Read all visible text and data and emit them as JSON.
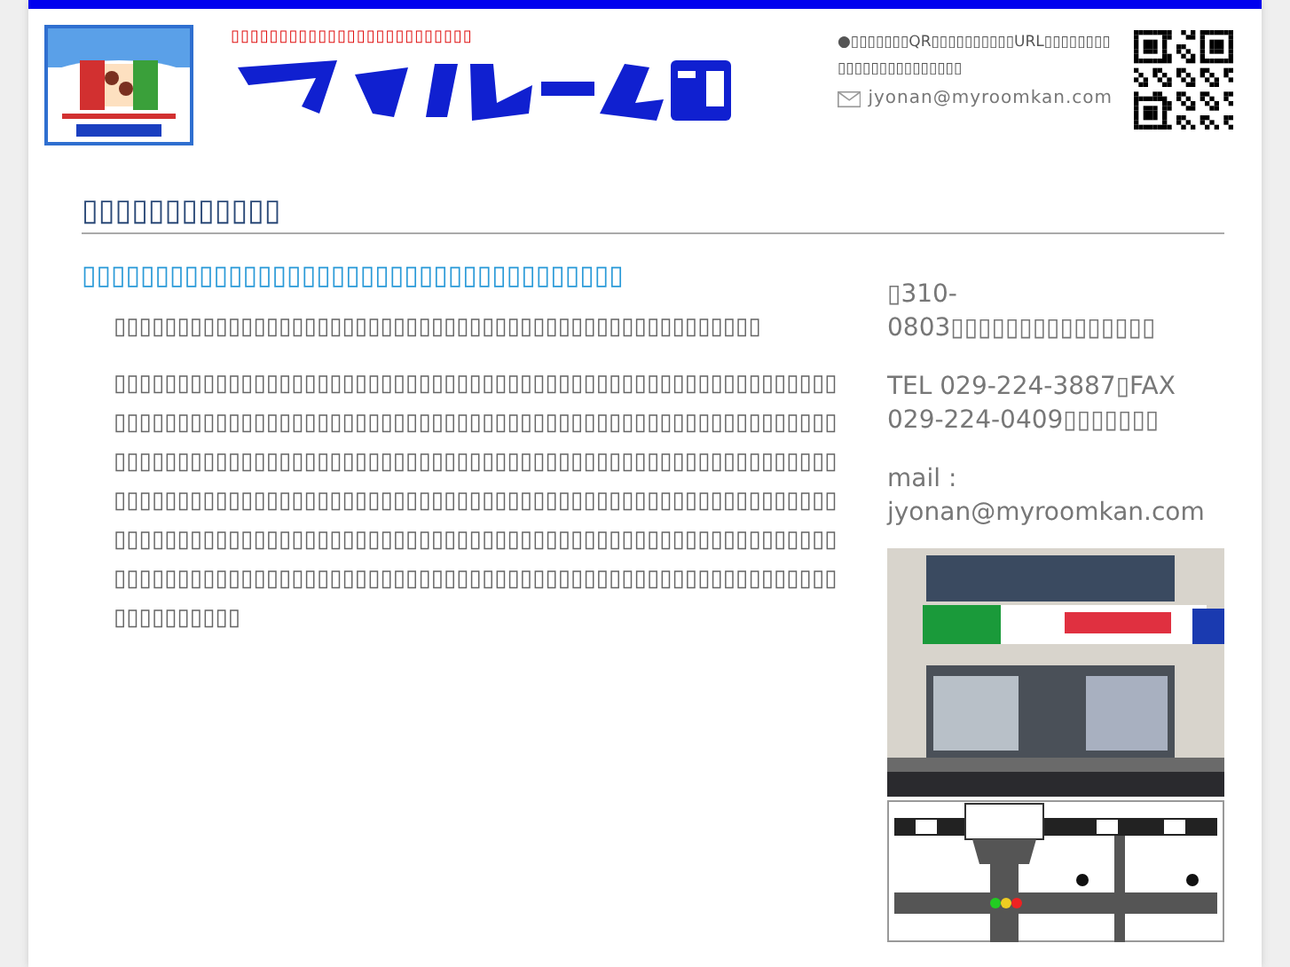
{
  "header": {
    "tagline": "▯▯▯▯▯▯▯▯▯▯▯▯▯▯▯▯▯▯▯▯▯▯▯▯▯",
    "notice": "●▯▯▯▯▯▯▯QR▯▯▯▯▯▯▯▯▯▯URL▯▯▯▯▯▯▯▯▯▯▯▯▯▯▯▯▯▯▯▯▯▯▯",
    "email": "jyonan@myroomkan.com"
  },
  "main": {
    "heading": "▯▯▯▯▯▯▯▯▯▯▯▯",
    "subheading": "▯▯▯▯▯▯▯▯▯▯▯▯▯▯▯▯▯▯▯▯▯▯▯▯▯▯▯▯▯▯▯▯▯▯▯▯▯",
    "paragraphs": [
      "▯▯▯▯▯▯▯▯▯▯▯▯▯▯▯▯▯▯▯▯▯▯▯▯▯▯▯▯▯▯▯▯▯▯▯▯▯▯▯▯▯▯▯▯▯▯▯▯▯▯▯",
      "▯▯▯▯▯▯▯▯▯▯▯▯▯▯▯▯▯▯▯▯▯▯▯▯▯▯▯▯▯▯▯▯▯▯▯▯▯▯▯▯▯▯▯▯▯▯▯▯▯▯▯▯▯▯▯▯▯▯▯▯▯▯▯▯▯▯▯▯▯▯▯▯▯▯▯▯▯▯▯▯▯▯▯▯▯▯▯▯▯▯▯▯▯▯▯▯▯▯▯▯▯▯▯▯▯▯▯▯▯▯▯▯▯▯▯▯▯▯▯▯▯▯▯▯▯▯▯▯▯▯▯▯▯▯▯▯▯▯▯▯▯▯▯▯▯▯▯▯▯▯▯▯▯▯▯▯▯▯▯▯▯▯▯▯▯▯▯▯▯▯▯▯▯▯▯▯▯▯▯▯▯▯▯▯▯▯▯▯▯▯▯▯▯▯▯▯▯▯▯▯▯▯▯▯▯▯▯▯▯▯▯▯▯▯▯▯▯▯▯▯▯▯▯▯▯▯▯▯▯▯▯▯▯▯▯▯▯▯▯▯▯▯▯▯▯▯▯▯▯▯▯▯▯▯▯▯▯▯▯▯▯▯▯▯▯▯▯▯▯▯▯▯▯▯▯▯▯▯▯▯▯▯▯▯▯▯▯▯▯▯▯▯▯▯▯▯▯▯▯▯▯▯▯▯▯▯▯▯▯▯▯▯▯▯▯▯▯▯▯▯▯▯▯▯▯▯▯▯▯▯▯▯▯▯▯▯▯▯▯▯▯▯▯▯▯▯▯▯▯▯▯▯"
    ]
  },
  "sidebar": {
    "address": "▯310-0803▯▯▯▯▯▯▯▯▯▯▯▯▯▯▯",
    "tel": "TEL 029-224-3887▯FAX 029-224-0409▯▯▯▯▯▯▯",
    "mail": "mail : jyonan@myroomkan.com"
  }
}
